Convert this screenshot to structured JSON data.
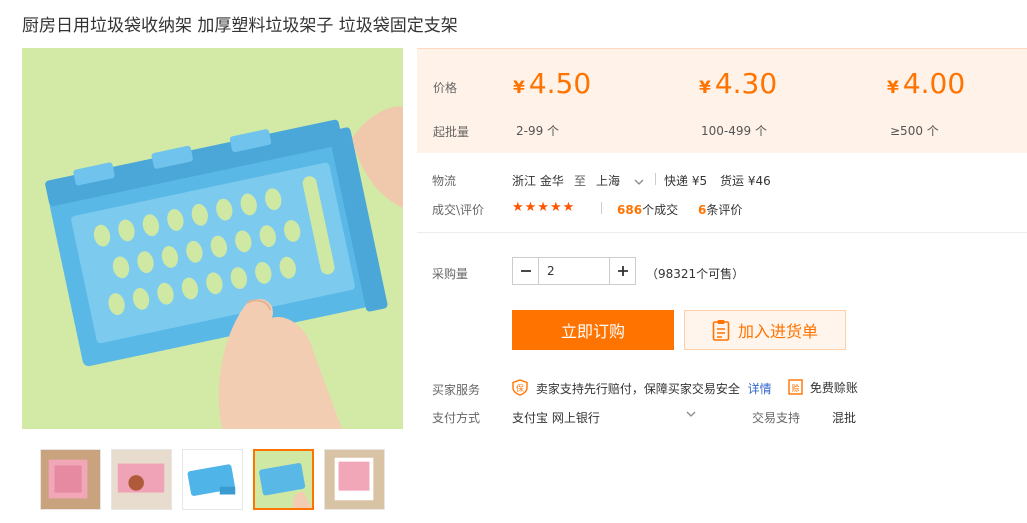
{
  "product": {
    "title": "厨房日用垃圾袋收纳架 加厚塑料垃圾架子 垃圾袋固定支架"
  },
  "gallery": {
    "thumbnail_count": 5,
    "active_index": 3
  },
  "pricing": {
    "price_label": "价格",
    "batch_label": "起批量",
    "currency": "¥",
    "tiers": [
      {
        "price": "4.50",
        "batch": "2-99 个"
      },
      {
        "price": "4.30",
        "batch": "100-499 个"
      },
      {
        "price": "4.00",
        "batch": "≥500 个"
      }
    ]
  },
  "logistics": {
    "label": "物流",
    "origin": "浙江 金华",
    "to": "至",
    "destination": "上海",
    "express": "快递 ¥5",
    "freight": "货运 ¥46"
  },
  "deals": {
    "label": "成交\\评价",
    "rating": 5,
    "count": "686",
    "count_suffix": "个成交",
    "reviews": "6",
    "reviews_suffix": "条评价"
  },
  "quantity": {
    "label": "采购量",
    "value": "2",
    "available": "（98321个可售）"
  },
  "actions": {
    "buy_now": "立即订购",
    "add_to_list": "加入进货单"
  },
  "services": {
    "label": "买家服务",
    "guarantee": "卖家支持先行赔付，保障买家交易安全",
    "details_link": "详情",
    "free_claim": "免费赊账"
  },
  "payment": {
    "label": "支付方式",
    "methods": "支付宝  网上银行",
    "trade_support_label": "交易支持",
    "trade_support_value": "混批"
  },
  "colors": {
    "accent": "#ff7300",
    "price_bg": "#fff2e8",
    "product_blue": "#4fb4e8",
    "image_bg": "#cfe8a4"
  }
}
